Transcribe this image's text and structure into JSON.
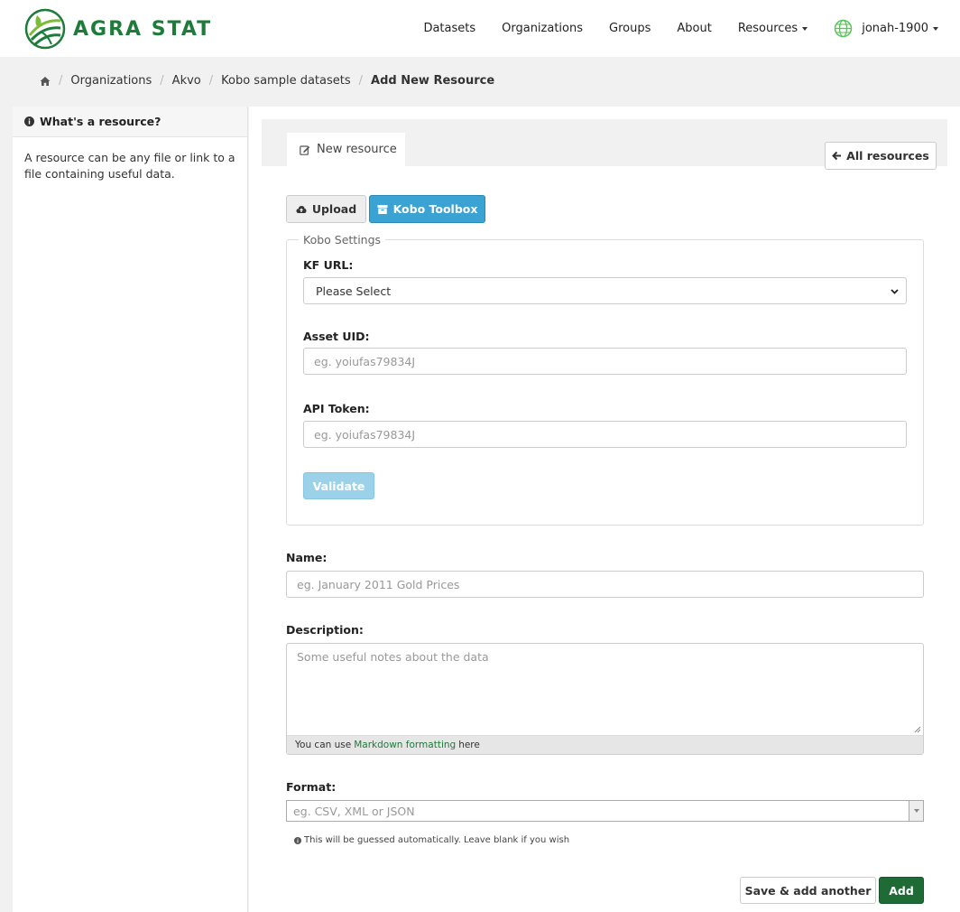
{
  "brand": {
    "name": "AGRA STAT",
    "accent": "#1e7b3a"
  },
  "nav": {
    "items": [
      "Datasets",
      "Organizations",
      "Groups",
      "About"
    ],
    "resources": "Resources",
    "user": "jonah-1900"
  },
  "breadcrumb": {
    "items": [
      "Organizations",
      "Akvo",
      "Kobo sample datasets"
    ],
    "active": "Add New Resource"
  },
  "sidebar": {
    "title": "What's a resource?",
    "body": "A resource can be any file or link to a file containing useful data."
  },
  "tabs": {
    "new_resource": "New resource",
    "all_resources": "All resources"
  },
  "source_buttons": {
    "upload": "Upload",
    "kobo": "Kobo Toolbox",
    "kobo_color": "#3aa3d4"
  },
  "kobo": {
    "legend": "Kobo Settings",
    "kf_url_label": "KF URL:",
    "kf_url_value": "Please Select",
    "asset_uid_label": "Asset UID:",
    "asset_uid_placeholder": "eg. yoiufas79834J",
    "api_token_label": "API Token:",
    "api_token_placeholder": "eg. yoiufas79834J",
    "validate": "Validate"
  },
  "form": {
    "name_label": "Name:",
    "name_placeholder": "eg. January 2011 Gold Prices",
    "description_label": "Description:",
    "description_placeholder": "Some useful notes about the data",
    "markdown_prefix": "You can use",
    "markdown_link": "Markdown formatting",
    "markdown_suffix": "here",
    "format_label": "Format:",
    "format_placeholder": "eg. CSV, XML or JSON",
    "format_hint": "This will be guessed automatically. Leave blank if you wish"
  },
  "actions": {
    "save_add_another": "Save & add another",
    "add": "Add",
    "add_color": "#1f6b35"
  }
}
